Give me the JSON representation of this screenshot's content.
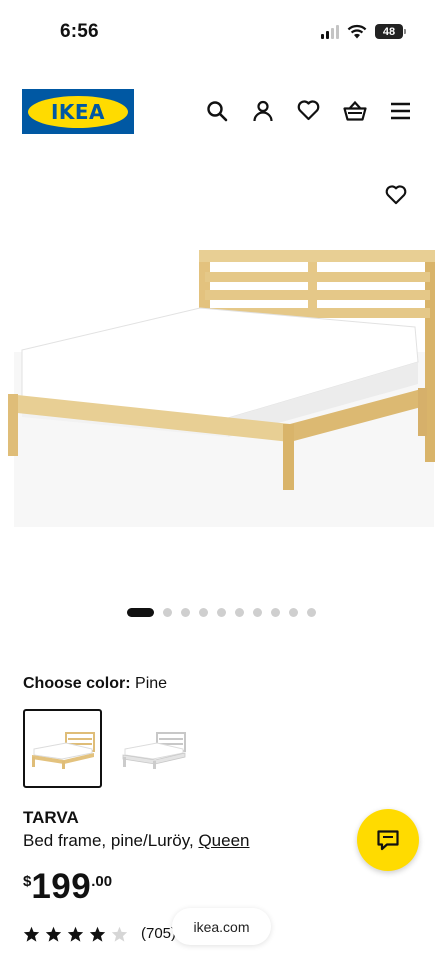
{
  "status_bar": {
    "time": "6:56",
    "battery": "48"
  },
  "header": {
    "logo_text": "IKEA"
  },
  "product": {
    "name": "TARVA",
    "description": "Bed frame, pine/Luröy, ",
    "size_link": "Queen",
    "price_currency": "$",
    "price_whole": "199",
    "price_cents": ".00",
    "rating_stars": 4,
    "rating_count": "(705)"
  },
  "color_selection": {
    "label": "Choose color:",
    "selected_value": "Pine",
    "swatches": [
      {
        "name": "Pine",
        "selected": true
      },
      {
        "name": "White",
        "selected": false
      }
    ]
  },
  "carousel": {
    "total": 10,
    "active_index": 0
  },
  "browser": {
    "url": "ikea.com"
  },
  "colors": {
    "ikea_blue": "#0058a3",
    "ikea_yellow": "#ffdb00",
    "pine": "#e8cf94"
  },
  "icons": {
    "header": [
      "search-icon",
      "account-icon",
      "heart-icon",
      "shopping-basket-icon",
      "menu-icon"
    ],
    "chat": "chat-icon"
  }
}
